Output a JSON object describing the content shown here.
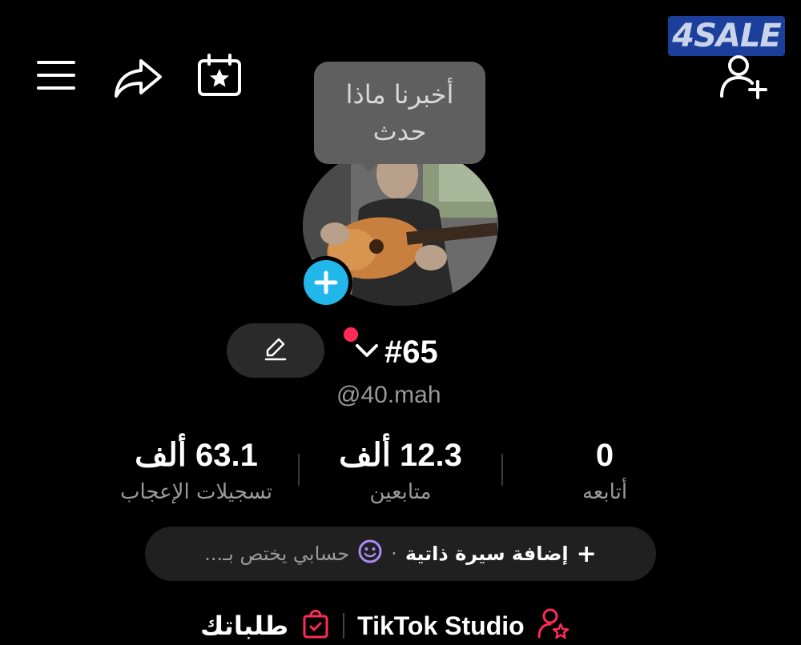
{
  "watermark": {
    "text": "4SALE"
  },
  "header": {
    "icons": [
      "menu-icon",
      "share-icon",
      "calendar-star-icon",
      "add-friend-icon"
    ]
  },
  "tooltip": {
    "line1": "أخبرنا ماذا",
    "line2": "حدث"
  },
  "profile": {
    "display_name": "#65",
    "username": "@40.mah"
  },
  "stats": {
    "following": {
      "value": "0",
      "label": "أتابعه"
    },
    "followers": {
      "value": "12.3 ألف",
      "label": "متابعين"
    },
    "likes": {
      "value": "63.1 ألف",
      "label": "تسجيلات الإعجاب"
    }
  },
  "bio": {
    "add_label": "إضافة سيرة ذاتية",
    "separator": "·",
    "hint": "حسابي يختص بـ..."
  },
  "bottom": {
    "studio_label": "TikTok Studio",
    "orders_label": "طلباتك"
  },
  "colors": {
    "accent_blue": "#22b7ea",
    "notification_red": "#fe2c55",
    "emoji_purple": "#a98bf4",
    "background": "#000000"
  }
}
